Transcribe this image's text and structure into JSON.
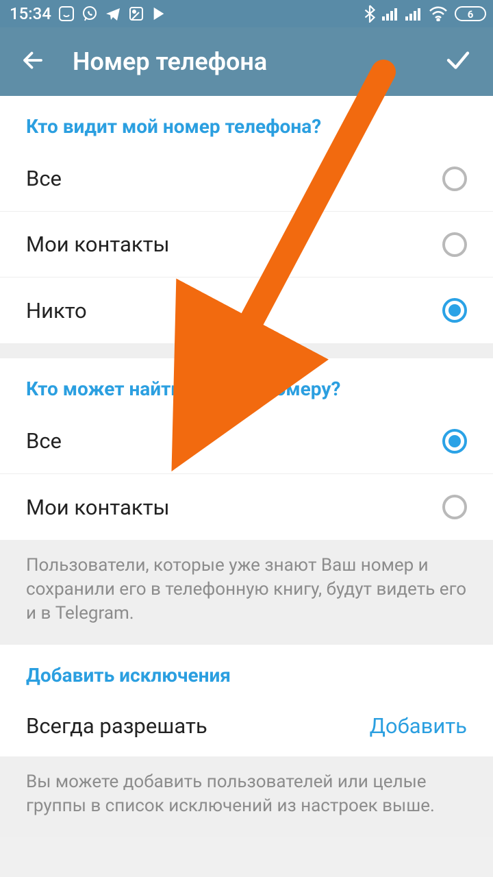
{
  "status": {
    "time": "15:34",
    "battery": "6",
    "icons": [
      "smile",
      "whatsapp",
      "telegram-plane",
      "maps",
      "play",
      "bluetooth",
      "signal1",
      "signal2",
      "wifi",
      "battery"
    ]
  },
  "appbar": {
    "title": "Номер телефона"
  },
  "section1": {
    "header": "Кто видит мой номер телефона?",
    "options": [
      {
        "label": "Все",
        "selected": false
      },
      {
        "label": "Мои контакты",
        "selected": false
      },
      {
        "label": "Никто",
        "selected": true
      }
    ]
  },
  "section2": {
    "header": "Кто может найти меня по номеру?",
    "options": [
      {
        "label": "Все",
        "selected": true
      },
      {
        "label": "Мои контакты",
        "selected": false
      }
    ],
    "note": "Пользователи, которые уже знают Ваш номер и сохранили его в телефонную книгу, будут видеть его и в Telegram."
  },
  "section3": {
    "header": "Добавить исключения",
    "row": {
      "label": "Всегда разрешать",
      "action": "Добавить"
    },
    "note": "Вы можете добавить пользователей или целые группы в список исключений из настроек выше."
  }
}
